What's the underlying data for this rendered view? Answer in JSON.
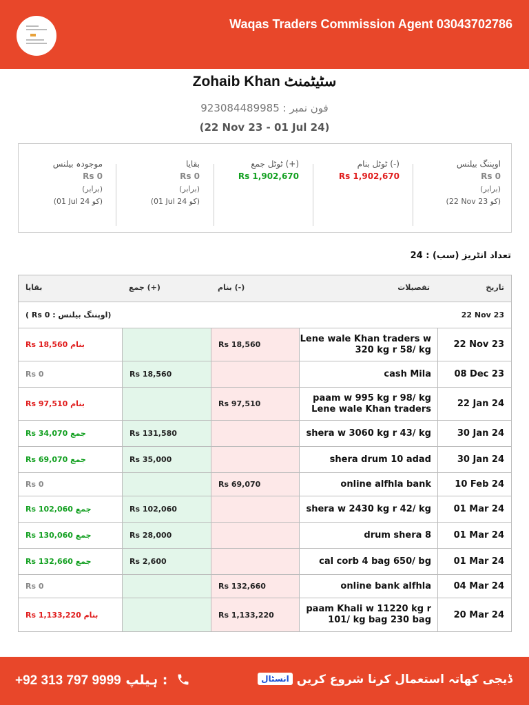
{
  "header": {
    "title": "Waqas Traders Commission Agent 03043702786"
  },
  "statement": {
    "title": "Zohaib Khan سٹیٹمنٹ",
    "phone": "فون نمبر : 923084489985",
    "range": "(22 Nov 23 - 01 Jul 24)"
  },
  "summary": {
    "opening": {
      "label": "اوپننگ بیلنس",
      "value": "Rs 0",
      "sub": "(برابر)",
      "date": "(22 Nov 23 کو)"
    },
    "debit": {
      "label": "ٹوٹل بنام (-)",
      "value": "Rs 1,902,670"
    },
    "credit": {
      "label": "ٹوٹل جمع (+)",
      "value": "Rs 1,902,670"
    },
    "remaining": {
      "label": "بقایا",
      "value": "Rs 0",
      "sub": "(برابر)",
      "date": "(01 Jul 24 کو)"
    },
    "current": {
      "label": "موجودہ بیلنس",
      "value": "Rs 0",
      "sub": "(برابر)",
      "date": "(01 Jul 24 کو)"
    }
  },
  "entries_count": "تعداد انٹریز (سب) : 24",
  "table": {
    "headers": {
      "date": "تاریخ",
      "details": "تفصیلات",
      "debit": "بنام (-)",
      "credit": "جمع (+)",
      "balance": "بقایا"
    },
    "opening_row": {
      "label": "( Rs 0 : اوپننگ بیلنس)",
      "date": "22 Nov 23"
    },
    "rows": [
      {
        "date": "22 Nov 23",
        "details": "Lene wale Khan traders w 320 kg r 58/ kg",
        "debit": "Rs 18,560",
        "credit": "",
        "balance": "Rs 18,560 بنام",
        "type": "red"
      },
      {
        "date": "08 Dec 23",
        "details": "cash Mila",
        "debit": "",
        "credit": "Rs 18,560",
        "balance": "Rs 0",
        "type": "grey"
      },
      {
        "date": "22 Jan 24",
        "details": "paam w 995 kg r 98/ kg Lene wale Khan traders",
        "debit": "Rs 97,510",
        "credit": "",
        "balance": "Rs 97,510 بنام",
        "type": "red"
      },
      {
        "date": "30 Jan 24",
        "details": "shera w 3060 kg r 43/ kg",
        "debit": "",
        "credit": "Rs 131,580",
        "balance": "Rs 34,070 جمع",
        "type": "green"
      },
      {
        "date": "30 Jan 24",
        "details": "shera drum 10 adad",
        "debit": "",
        "credit": "Rs 35,000",
        "balance": "Rs 69,070 جمع",
        "type": "green"
      },
      {
        "date": "10 Feb 24",
        "details": "online alfhla bank",
        "debit": "Rs 69,070",
        "credit": "",
        "balance": "Rs 0",
        "type": "grey"
      },
      {
        "date": "01 Mar 24",
        "details": "shera w 2430 kg r 42/ kg",
        "debit": "",
        "credit": "Rs 102,060",
        "balance": "Rs 102,060 جمع",
        "type": "green"
      },
      {
        "date": "01 Mar 24",
        "details": "drum shera 8",
        "debit": "",
        "credit": "Rs 28,000",
        "balance": "Rs 130,060 جمع",
        "type": "green"
      },
      {
        "date": "01 Mar 24",
        "details": "cal corb 4 bag 650/ bg",
        "debit": "",
        "credit": "Rs 2,600",
        "balance": "Rs 132,660 جمع",
        "type": "green"
      },
      {
        "date": "04 Mar 24",
        "details": "online bank alfhla",
        "debit": "Rs 132,660",
        "credit": "",
        "balance": "Rs 0",
        "type": "grey"
      },
      {
        "date": "20 Mar 24",
        "details": "paam Khali w 11220 kg r 101/ kg bag 230 bag",
        "debit": "Rs 1,133,220",
        "credit": "",
        "balance": "Rs 1,133,220 بنام",
        "type": "red"
      }
    ]
  },
  "footer": {
    "help_label": "ہیلپ :",
    "phone": "+92 313 797 9999",
    "cta": "ڈیجی کھاتہ استعمال کرنا شروع کریں",
    "install": "انسٹال"
  },
  "colors": {
    "brand": "#e8472a",
    "debit": "#e01c1c",
    "credit": "#13a021",
    "neutral": "#888888"
  }
}
